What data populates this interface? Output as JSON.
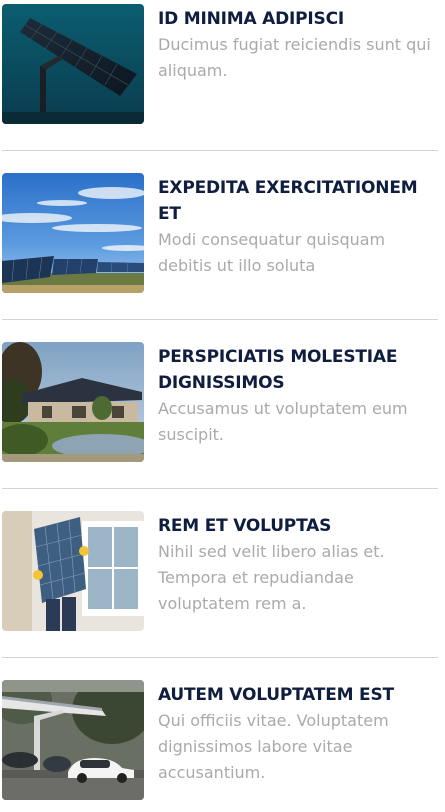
{
  "posts": [
    {
      "title": "ID MINIMA ADIPISCI",
      "description": "Ducimus fugiat reiciendis sunt qui aliquam.",
      "image": "solar-panel-tracker-image"
    },
    {
      "title": "EXPEDITA EXERCITATIONEM ET",
      "description": "Modi consequatur quisquam debitis ut illo soluta",
      "image": "solar-farm-image"
    },
    {
      "title": "PERSPICIATIS MOLESTIAE DIGNISSIMOS",
      "description": "Accusamus ut voluptatem eum suscipit.",
      "image": "house-with-solar-roof-image"
    },
    {
      "title": "REM ET VOLUPTAS",
      "description": "Nihil sed velit libero alias et. Tempora et repudiandae voluptatem rem a.",
      "image": "worker-carrying-panel-image"
    },
    {
      "title": "AUTEM VOLUPTATEM EST",
      "description": "Qui officiis vitae. Voluptatem dignissimos labore vitae accusantium.",
      "image": "solar-carport-image"
    }
  ]
}
